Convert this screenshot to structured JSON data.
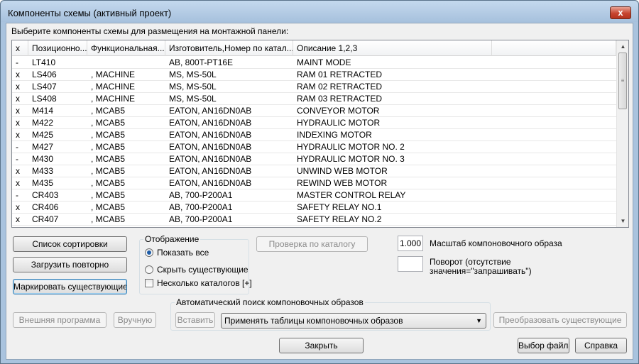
{
  "window": {
    "title": "Компоненты схемы (активный проект)",
    "close_glyph": "x"
  },
  "prompt": "Выберите компоненты схемы для размещения на монтажной панели:",
  "table": {
    "columns": [
      "x",
      "Позиционно...",
      "Функциональная...",
      "Изготовитель,Номер по катал...",
      "Описание 1,2,3",
      ""
    ],
    "rows": [
      [
        "-",
        "LT410",
        "",
        "AB, 800T-PT16E",
        "MAINT MODE"
      ],
      [
        "x",
        "LS406",
        ", MACHINE",
        "MS, MS-50L",
        "RAM 01 RETRACTED"
      ],
      [
        "x",
        "LS407",
        ", MACHINE",
        "MS, MS-50L",
        "RAM 02 RETRACTED"
      ],
      [
        "x",
        "LS408",
        ", MACHINE",
        "MS, MS-50L",
        "RAM 03 RETRACTED"
      ],
      [
        "x",
        "M414",
        ", MCAB5",
        "EATON, AN16DN0AB",
        "CONVEYOR MOTOR"
      ],
      [
        "x",
        "M422",
        ", MCAB5",
        "EATON, AN16DN0AB",
        "HYDRAULIC MOTOR"
      ],
      [
        "x",
        "M425",
        ", MCAB5",
        "EATON, AN16DN0AB",
        "INDEXING MOTOR"
      ],
      [
        "-",
        "M427",
        ", MCAB5",
        "EATON, AN16DN0AB",
        "HYDRAULIC MOTOR NO. 2"
      ],
      [
        "-",
        "M430",
        ", MCAB5",
        "EATON, AN16DN0AB",
        "HYDRAULIC MOTOR NO. 3"
      ],
      [
        "x",
        "M433",
        ", MCAB5",
        "EATON, AN16DN0AB",
        "UNWIND WEB MOTOR"
      ],
      [
        "x",
        "M435",
        ", MCAB5",
        "EATON, AN16DN0AB",
        "REWIND WEB MOTOR"
      ],
      [
        "-",
        "CR403",
        ", MCAB5",
        "AB, 700-P200A1",
        "MASTER CONTROL RELAY"
      ],
      [
        "x",
        "CR406",
        ", MCAB5",
        "AB, 700-P200A1",
        "SAFETY RELAY NO.1"
      ],
      [
        "x",
        "CR407",
        ", MCAB5",
        "AB, 700-P200A1",
        "SAFETY RELAY NO.2"
      ]
    ]
  },
  "buttons": {
    "sort_list": "Список сортировки",
    "reload": "Загрузить повторно",
    "mark_existing": "Маркировать существующие",
    "catalog_check": "Проверка по каталогу",
    "external_program": "Внешняя программа",
    "manual": "Вручную",
    "insert": "Вставить",
    "convert_existing": "Преобразовать существующие",
    "close": "Закрыть",
    "choose_file": "Выбор файла",
    "help": "Справка"
  },
  "display_group": {
    "label": "Отображение",
    "show_all": "Показать все",
    "hide_existing": "Скрыть существующие",
    "multi_catalogs": "Несколько каталогов [+]",
    "selected": "show_all"
  },
  "scale": {
    "value": "1.000",
    "label": "Масштаб компоновочного образа"
  },
  "rotation": {
    "value": "",
    "label_line1": "Поворот (отсутствие",
    "label_line2": "значения=\"запрашивать\")"
  },
  "auto_search": {
    "label": "Автоматический поиск компоновочных образов",
    "option": "Применять таблицы компоновочных образов"
  },
  "colors": {
    "titlebar": "#a9c3de",
    "client": "#f0f0f0",
    "close": "#c7452f"
  }
}
